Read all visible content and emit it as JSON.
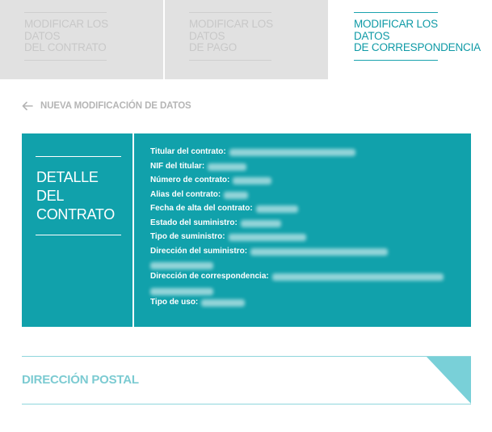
{
  "tabs": [
    {
      "label": "MODIFICAR LOS\nDATOS\nDEL CONTRATO",
      "active": false
    },
    {
      "label": "MODIFICAR LOS\nDATOS\nDE PAGO",
      "active": false
    },
    {
      "label": "MODIFICAR LOS\nDATOS\nDE CORRESPONDENCIA",
      "active": true
    }
  ],
  "back_link": {
    "label": "NUEVA MODIFICACIÓN DE DATOS",
    "icon": "arrow-left-icon"
  },
  "detail": {
    "title": "DETALLE\nDEL\nCONTRATO",
    "fields": [
      {
        "label": "Titular del contrato:"
      },
      {
        "label": "NIF del titular:"
      },
      {
        "label": "Número de contrato:"
      },
      {
        "label": "Alias del contrato:"
      },
      {
        "label": "Fecha de alta del contrato:"
      },
      {
        "label": "Estado del suministro:"
      },
      {
        "label": "Tipo de suministro:"
      },
      {
        "label": "Dirección del suministro:"
      },
      {
        "label": "Dirección de correspondencia:"
      },
      {
        "label": "Tipo de uso:"
      }
    ]
  },
  "postal": {
    "title": "DIRECCIÓN POSTAL"
  },
  "colors": {
    "accent": "#11a1ab",
    "tab_inactive": "#e1e1e1",
    "postal_corner": "#79d0d8"
  }
}
